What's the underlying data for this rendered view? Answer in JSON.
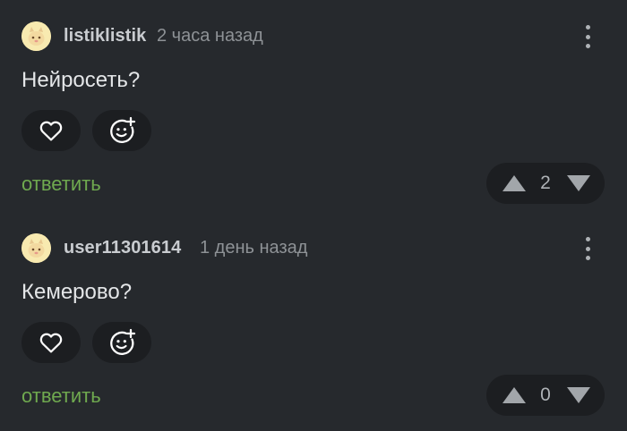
{
  "comments": [
    {
      "username": "listiklistik",
      "timestamp": "2 часа назад",
      "text": "Нейросеть?",
      "reply_label": "ответить",
      "rating": "2",
      "avatar_icon": "avatar-cat-face",
      "menu_icon": "more-vertical-icon"
    },
    {
      "username": "user11301614",
      "timestamp": "1 день назад",
      "text": "Кемерово?",
      "reply_label": "ответить",
      "rating": "0",
      "avatar_icon": "avatar-cat-face",
      "menu_icon": "more-vertical-icon"
    }
  ],
  "colors": {
    "background": "#26292d",
    "pill": "#1c1e21",
    "reply": "#6fa94f",
    "avatar": "#f6e7a8"
  }
}
